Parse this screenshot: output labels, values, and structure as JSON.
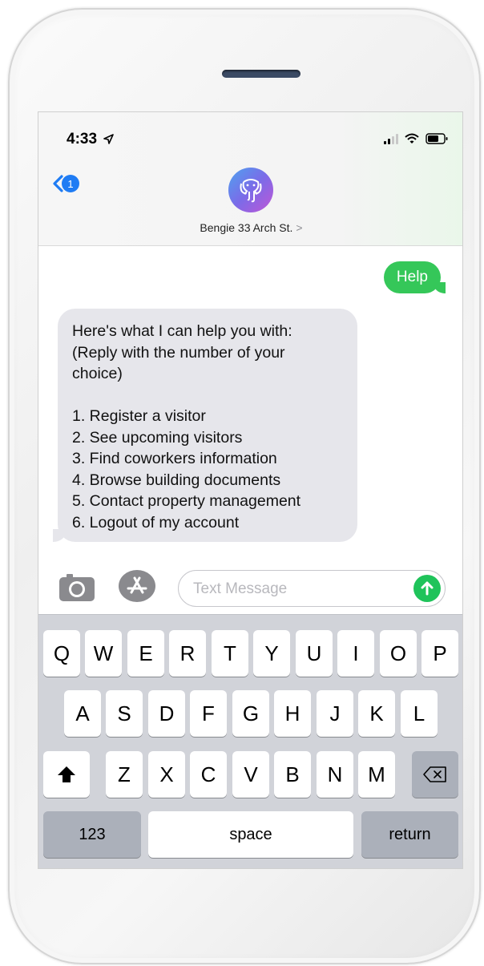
{
  "status_bar": {
    "time": "4:33"
  },
  "header": {
    "back_badge": "1",
    "contact_name": "Bengie 33 Arch St.",
    "contact_chevron": ">"
  },
  "messages": {
    "outgoing": "Help",
    "incoming_lines": [
      "Here's what I can help you with:",
      "(Reply with the number of your",
      "choice)",
      "",
      "1. Register a visitor",
      "2. See upcoming visitors",
      "3. Find coworkers information",
      "4. Browse building documents",
      "5. Contact property management",
      "6. Logout of my account"
    ]
  },
  "input": {
    "placeholder": "Text Message"
  },
  "keyboard": {
    "row1": [
      "Q",
      "W",
      "E",
      "R",
      "T",
      "Y",
      "U",
      "I",
      "O",
      "P"
    ],
    "row2": [
      "A",
      "S",
      "D",
      "F",
      "G",
      "H",
      "J",
      "K",
      "L"
    ],
    "row3": [
      "Z",
      "X",
      "C",
      "V",
      "B",
      "N",
      "M"
    ],
    "numbers_label": "123",
    "space_label": "space",
    "return_label": "return"
  },
  "colors": {
    "imessage_green": "#35c759",
    "ios_blue": "#1f7cf4",
    "incoming_bubble": "#e6e6eb",
    "keyboard_bg": "#d1d3d9"
  },
  "icons": [
    "location-arrow-icon",
    "signal-icon",
    "wifi-icon",
    "battery-icon",
    "back-chevron-icon",
    "elephant-logo-icon",
    "camera-icon",
    "app-store-icon",
    "send-arrow-icon",
    "shift-icon",
    "backspace-icon"
  ]
}
